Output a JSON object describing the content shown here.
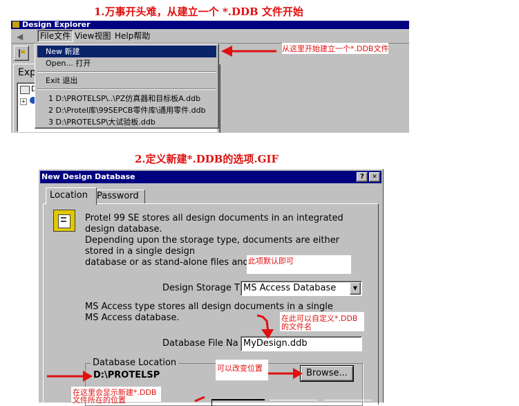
{
  "captions": {
    "top": "1.万事开头难，从建立一个 *.DDB 文件开始",
    "mid": "2.定义新建*.DDB的选项.GIF"
  },
  "explorer": {
    "title": "Design Explorer",
    "menubar": [
      "File文件",
      "View视图",
      "Help帮助"
    ],
    "panel_label": "Expl",
    "tree_item": "D",
    "menu": {
      "items": [
        "New 新建",
        "Open... 打开",
        "Exit 退出"
      ],
      "recent": [
        "1 D:\\PROTELSP\\..\\PZ仿真器和目标板A.ddb",
        "2 D:\\Protel库\\99SEPCB零件库\\通用零件.ddb",
        "3 D:\\PROTELSP\\大试验板.ddb"
      ]
    },
    "annotation": "从这里开始建立一个*.DDB文件"
  },
  "dialog": {
    "title": "New Design Database",
    "title_buttons": [
      "?",
      "✕"
    ],
    "tabs": [
      "Location",
      "Password"
    ],
    "description": [
      "Protel 99 SE stores all design documents in an integrated",
      "design database.",
      "Depending upon the storage type, documents are either",
      "stored in a single design",
      "database or as stand-alone files and"
    ],
    "storage_label": "Design Storage T",
    "storage_value": "MS Access Database",
    "access_desc": [
      "MS Access type stores all design documents in a single",
      "MS Access database."
    ],
    "filename_label": "Database File Na",
    "filename_value": "MyDesign.ddb",
    "location_group": "Database Location",
    "location_value": "D:\\PROTELSP",
    "browse_label": "Browse..."
  },
  "annotations": {
    "default_ok": "此项默认即可",
    "custom_name": [
      "在此可以自定义*.DDB",
      "的文件名"
    ],
    "change_location": "可以改变位置",
    "shows_location": [
      "在这里会显示新建*.DDB",
      "文件所在的位置"
    ]
  },
  "colors": {
    "red": "#e01010",
    "titlebar": "#000080",
    "menu_highlight": "#0a246a",
    "face": "#c0c0c0"
  }
}
